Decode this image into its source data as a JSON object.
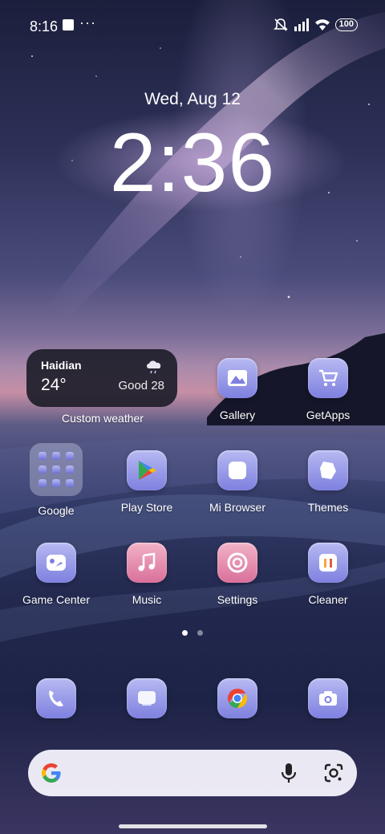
{
  "status_bar": {
    "time": "8:16",
    "dots": "···",
    "battery": "100"
  },
  "lock": {
    "date": "Wed, Aug 12",
    "time": "2:36"
  },
  "weather": {
    "city": "Haidian",
    "temp": "24°",
    "aqi": "Good 28",
    "label": "Custom weather",
    "icon": "cloud-rain-icon"
  },
  "apps": {
    "gallery": "Gallery",
    "getapps": "GetApps",
    "google": "Google",
    "playstore": "Play Store",
    "mibrowser": "Mi Browser",
    "themes": "Themes",
    "gamecenter": "Game Center",
    "music": "Music",
    "settings": "Settings",
    "cleaner": "Cleaner"
  },
  "dock": [
    "phone-icon",
    "messages-icon",
    "chrome-icon",
    "camera-icon"
  ],
  "pager": {
    "pages": 2,
    "active": 1
  },
  "colors": {
    "icon_blue": "#7e80df",
    "icon_pink": "#d9709a"
  }
}
